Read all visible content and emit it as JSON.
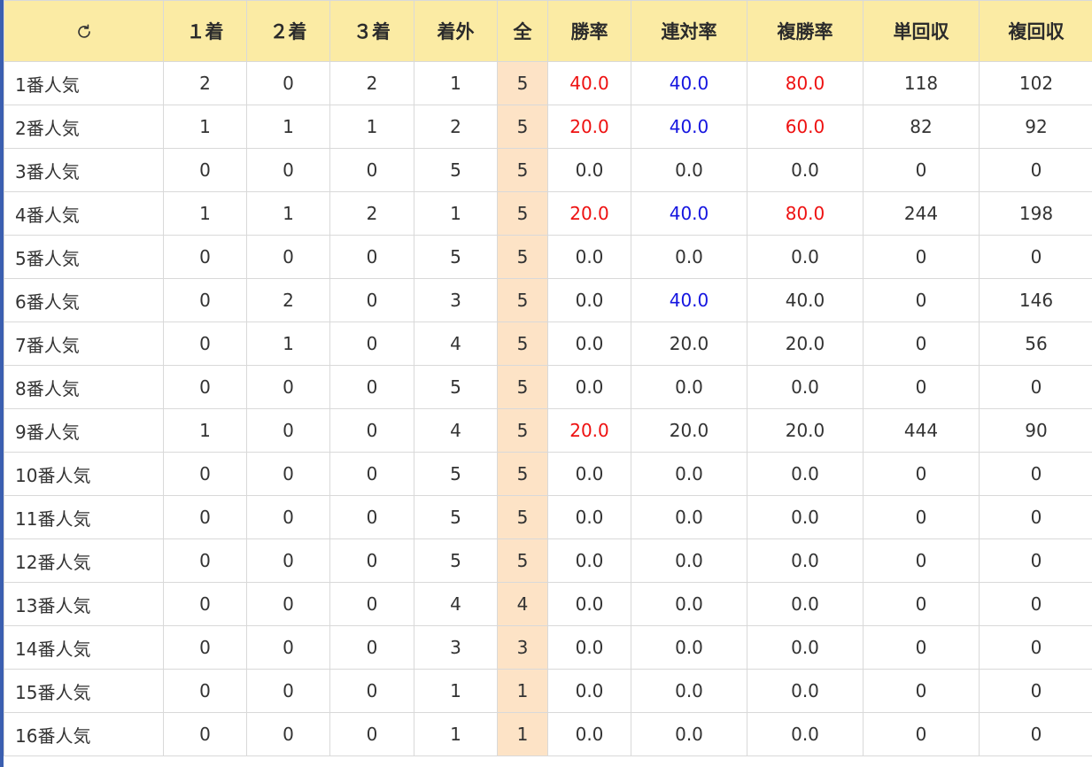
{
  "colors": {
    "header_bg": "#fbeba4",
    "total_col_bg": "#fde3c6",
    "highlight_red": "#ee1111",
    "highlight_blue": "#1515e0"
  },
  "header": {
    "refresh_icon": "refresh-icon",
    "columns": [
      "１着",
      "２着",
      "３着",
      "着外",
      "全",
      "勝率",
      "連対率",
      "複勝率",
      "単回収",
      "複回収"
    ]
  },
  "rows": [
    {
      "label": "1番人気",
      "c1": "2",
      "c2": "0",
      "c3": "2",
      "out": "1",
      "total": "5",
      "win": "40.0",
      "rentai": "40.0",
      "fukusho": "80.0",
      "tan": "118",
      "fuku": "102"
    },
    {
      "label": "2番人気",
      "c1": "1",
      "c2": "1",
      "c3": "1",
      "out": "2",
      "total": "5",
      "win": "20.0",
      "rentai": "40.0",
      "fukusho": "60.0",
      "tan": "82",
      "fuku": "92"
    },
    {
      "label": "3番人気",
      "c1": "0",
      "c2": "0",
      "c3": "0",
      "out": "5",
      "total": "5",
      "win": "0.0",
      "rentai": "0.0",
      "fukusho": "0.0",
      "tan": "0",
      "fuku": "0"
    },
    {
      "label": "4番人気",
      "c1": "1",
      "c2": "1",
      "c3": "2",
      "out": "1",
      "total": "5",
      "win": "20.0",
      "rentai": "40.0",
      "fukusho": "80.0",
      "tan": "244",
      "fuku": "198"
    },
    {
      "label": "5番人気",
      "c1": "0",
      "c2": "0",
      "c3": "0",
      "out": "5",
      "total": "5",
      "win": "0.0",
      "rentai": "0.0",
      "fukusho": "0.0",
      "tan": "0",
      "fuku": "0"
    },
    {
      "label": "6番人気",
      "c1": "0",
      "c2": "2",
      "c3": "0",
      "out": "3",
      "total": "5",
      "win": "0.0",
      "rentai": "40.0",
      "fukusho": "40.0",
      "tan": "0",
      "fuku": "146"
    },
    {
      "label": "7番人気",
      "c1": "0",
      "c2": "1",
      "c3": "0",
      "out": "4",
      "total": "5",
      "win": "0.0",
      "rentai": "20.0",
      "fukusho": "20.0",
      "tan": "0",
      "fuku": "56"
    },
    {
      "label": "8番人気",
      "c1": "0",
      "c2": "0",
      "c3": "0",
      "out": "5",
      "total": "5",
      "win": "0.0",
      "rentai": "0.0",
      "fukusho": "0.0",
      "tan": "0",
      "fuku": "0"
    },
    {
      "label": "9番人気",
      "c1": "1",
      "c2": "0",
      "c3": "0",
      "out": "4",
      "total": "5",
      "win": "20.0",
      "rentai": "20.0",
      "fukusho": "20.0",
      "tan": "444",
      "fuku": "90"
    },
    {
      "label": "10番人気",
      "c1": "0",
      "c2": "0",
      "c3": "0",
      "out": "5",
      "total": "5",
      "win": "0.0",
      "rentai": "0.0",
      "fukusho": "0.0",
      "tan": "0",
      "fuku": "0"
    },
    {
      "label": "11番人気",
      "c1": "0",
      "c2": "0",
      "c3": "0",
      "out": "5",
      "total": "5",
      "win": "0.0",
      "rentai": "0.0",
      "fukusho": "0.0",
      "tan": "0",
      "fuku": "0"
    },
    {
      "label": "12番人気",
      "c1": "0",
      "c2": "0",
      "c3": "0",
      "out": "5",
      "total": "5",
      "win": "0.0",
      "rentai": "0.0",
      "fukusho": "0.0",
      "tan": "0",
      "fuku": "0"
    },
    {
      "label": "13番人気",
      "c1": "0",
      "c2": "0",
      "c3": "0",
      "out": "4",
      "total": "4",
      "win": "0.0",
      "rentai": "0.0",
      "fukusho": "0.0",
      "tan": "0",
      "fuku": "0"
    },
    {
      "label": "14番人気",
      "c1": "0",
      "c2": "0",
      "c3": "0",
      "out": "3",
      "total": "3",
      "win": "0.0",
      "rentai": "0.0",
      "fukusho": "0.0",
      "tan": "0",
      "fuku": "0"
    },
    {
      "label": "15番人気",
      "c1": "0",
      "c2": "0",
      "c3": "0",
      "out": "1",
      "total": "1",
      "win": "0.0",
      "rentai": "0.0",
      "fukusho": "0.0",
      "tan": "0",
      "fuku": "0"
    },
    {
      "label": "16番人気",
      "c1": "0",
      "c2": "0",
      "c3": "0",
      "out": "1",
      "total": "1",
      "win": "0.0",
      "rentai": "0.0",
      "fukusho": "0.0",
      "tan": "0",
      "fuku": "0"
    }
  ],
  "highlights": {
    "win": {
      "color": "red"
    },
    "rentai": {
      "color": "blue"
    },
    "fukusho": {
      "color": "red"
    },
    "red_win_rows": [
      0,
      1,
      3,
      8
    ],
    "blue_rentai_rows": [
      0,
      1,
      3,
      5
    ],
    "red_fukusho_rows": [
      0,
      1,
      3
    ]
  }
}
